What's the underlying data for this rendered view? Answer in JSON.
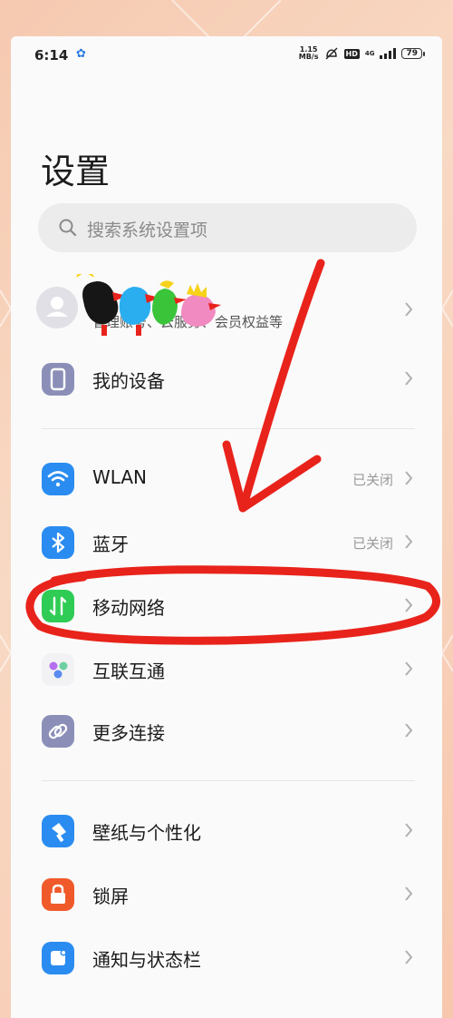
{
  "status_bar": {
    "time": "6:14",
    "speed_top": "1.15",
    "speed_unit": "MB/s",
    "hd": "HD",
    "network": "4G",
    "battery": "79"
  },
  "page": {
    "title": "设置"
  },
  "search": {
    "placeholder": "搜索系统设置项"
  },
  "account": {
    "subtitle": "管理账号、云服务、会员权益等"
  },
  "groups": {
    "device": {
      "label": "我的设备"
    },
    "wlan": {
      "label": "WLAN",
      "value": "已关闭"
    },
    "bluetooth": {
      "label": "蓝牙",
      "value": "已关闭"
    },
    "mobile": {
      "label": "移动网络"
    },
    "interconnect": {
      "label": "互联互通"
    },
    "more": {
      "label": "更多连接"
    },
    "wallpaper": {
      "label": "壁纸与个性化"
    },
    "lockscreen": {
      "label": "锁屏"
    },
    "notification": {
      "label": "通知与状态栏"
    }
  },
  "colors": {
    "device_icon": "#8b8fb8",
    "wlan_icon": "#2a8cf0",
    "bluetooth_icon": "#2a8cf0",
    "mobile_icon": "#2fcc55",
    "more_icon": "#8b8fb8",
    "wallpaper_icon": "#2a8cf0",
    "lockscreen_icon": "#f05a2a",
    "notification_icon": "#2a8cf0",
    "annotation": "#e8231b"
  }
}
